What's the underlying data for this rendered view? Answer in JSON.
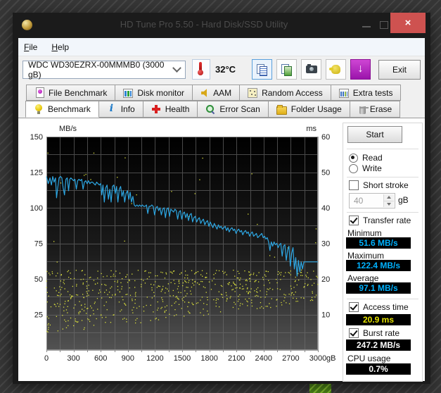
{
  "window": {
    "title": "HD Tune Pro 5.50 - Hard Disk/SSD Utility"
  },
  "menu": {
    "items": [
      {
        "label": "File"
      },
      {
        "label": "Help"
      }
    ]
  },
  "toolbar": {
    "drive_select_value": "WDC WD30EZRX-00MMMB0 (3000 gB)",
    "temperature": "32°C",
    "exit_label": "Exit"
  },
  "tabs": {
    "row_top": [
      {
        "label": "File Benchmark",
        "icon": "file-benchmark"
      },
      {
        "label": "Disk monitor",
        "icon": "disk-monitor"
      },
      {
        "label": "AAM",
        "icon": "aam"
      },
      {
        "label": "Random Access",
        "icon": "random-access"
      },
      {
        "label": "Extra tests",
        "icon": "extra-tests"
      }
    ],
    "row_bottom": [
      {
        "label": "Benchmark",
        "icon": "benchmark",
        "active": true
      },
      {
        "label": "Info",
        "icon": "info"
      },
      {
        "label": "Health",
        "icon": "health"
      },
      {
        "label": "Error Scan",
        "icon": "error-scan"
      },
      {
        "label": "Folder Usage",
        "icon": "folder-usage"
      },
      {
        "label": "Erase",
        "icon": "erase"
      }
    ]
  },
  "benchmark_panel": {
    "start_label": "Start",
    "read_label": "Read",
    "read_selected": true,
    "write_label": "Write",
    "write_selected": false,
    "short_stroke_label": "Short stroke",
    "short_stroke_checked": false,
    "capacity_value": "40",
    "capacity_unit": "gB",
    "transfer_rate_label": "Transfer rate",
    "transfer_rate_checked": true,
    "minimum_label": "Minimum",
    "minimum_value": "51.6 MB/s",
    "maximum_label": "Maximum",
    "maximum_value": "122.4 MB/s",
    "average_label": "Average",
    "average_value": "97.1 MB/s",
    "access_time_label": "Access time",
    "access_time_checked": true,
    "access_time_value": "20.9 ms",
    "burst_rate_label": "Burst rate",
    "burst_rate_checked": true,
    "burst_rate_value": "247.2 MB/s",
    "cpu_usage_label": "CPU usage",
    "cpu_usage_value": "0.7%"
  },
  "colors": {
    "transfer_line": "#2da6e2",
    "access_dots": "#dde23d",
    "value_cyan": "#00b2ff",
    "value_yellow": "#e6e400",
    "close_button": "#ce5250",
    "plot_top": "#000000",
    "plot_bottom": "#525252",
    "gridline": "#6f6f6f"
  },
  "chart_data": {
    "type": "line",
    "title": "Read benchmark: transfer rate and access time vs disk position",
    "x_axis": {
      "min": 0,
      "max": 3000,
      "tick_step": 300,
      "gridline_step": 150,
      "unit_suffix": "gB",
      "ticks": [
        0,
        300,
        600,
        900,
        1200,
        1500,
        1800,
        2100,
        2400,
        2700,
        3000
      ]
    },
    "left_axis": {
      "label": "MB/s",
      "min": 0,
      "max": 150,
      "gridline_step": 12.5,
      "ticks": [
        25,
        50,
        75,
        100,
        125,
        150
      ]
    },
    "right_axis": {
      "label": "ms",
      "min": 0,
      "max": 60,
      "ticks": [
        10,
        20,
        30,
        40,
        50,
        60
      ]
    },
    "legend": "none",
    "series": [
      {
        "name": "transfer-rate",
        "type": "line",
        "axis": "left",
        "unit": "MB/s",
        "color": "#2da6e2",
        "points": [
          [
            0,
            122
          ],
          [
            20,
            117
          ],
          [
            40,
            121
          ],
          [
            55,
            116
          ],
          [
            70,
            122
          ],
          [
            85,
            118
          ],
          [
            100,
            121
          ],
          [
            112,
            107
          ],
          [
            125,
            114
          ],
          [
            140,
            121
          ],
          [
            155,
            122
          ],
          [
            170,
            121
          ],
          [
            185,
            114
          ],
          [
            200,
            109
          ],
          [
            215,
            120
          ],
          [
            230,
            121
          ],
          [
            245,
            112
          ],
          [
            258,
            120
          ],
          [
            270,
            121
          ],
          [
            285,
            120
          ],
          [
            300,
            119
          ],
          [
            315,
            120
          ],
          [
            330,
            113
          ],
          [
            345,
            119
          ],
          [
            360,
            120
          ],
          [
            375,
            119
          ],
          [
            390,
            120
          ],
          [
            405,
            113
          ],
          [
            420,
            118
          ],
          [
            435,
            119
          ],
          [
            450,
            117
          ],
          [
            465,
            119
          ],
          [
            480,
            117
          ],
          [
            495,
            118
          ],
          [
            510,
            118
          ],
          [
            525,
            117
          ],
          [
            540,
            116
          ],
          [
            555,
            118
          ],
          [
            570,
            117
          ],
          [
            585,
            116
          ],
          [
            600,
            117
          ],
          [
            612,
            109
          ],
          [
            625,
            116
          ],
          [
            640,
            104
          ],
          [
            655,
            114
          ],
          [
            670,
            116
          ],
          [
            685,
            106
          ],
          [
            700,
            113
          ],
          [
            715,
            104
          ],
          [
            730,
            115
          ],
          [
            745,
            116
          ],
          [
            760,
            110
          ],
          [
            775,
            115
          ],
          [
            790,
            104
          ],
          [
            805,
            113
          ],
          [
            820,
            115
          ],
          [
            835,
            108
          ],
          [
            850,
            112
          ],
          [
            865,
            104
          ],
          [
            880,
            110
          ],
          [
            895,
            112
          ],
          [
            910,
            106
          ],
          [
            925,
            111
          ],
          [
            940,
            104
          ],
          [
            955,
            108
          ],
          [
            970,
            102
          ],
          [
            985,
            101
          ],
          [
            1000,
            102
          ],
          [
            1015,
            101
          ],
          [
            1030,
            102
          ],
          [
            1045,
            101
          ],
          [
            1060,
            102
          ],
          [
            1075,
            101
          ],
          [
            1090,
            101
          ],
          [
            1105,
            102
          ],
          [
            1120,
            96
          ],
          [
            1135,
            101
          ],
          [
            1150,
            101
          ],
          [
            1165,
            102
          ],
          [
            1180,
            101
          ],
          [
            1195,
            95
          ],
          [
            1210,
            100
          ],
          [
            1225,
            101
          ],
          [
            1240,
            98
          ],
          [
            1255,
            100
          ],
          [
            1270,
            95
          ],
          [
            1285,
            99
          ],
          [
            1300,
            100
          ],
          [
            1315,
            93
          ],
          [
            1330,
            99
          ],
          [
            1345,
            100
          ],
          [
            1360,
            94
          ],
          [
            1375,
            99
          ],
          [
            1390,
            98
          ],
          [
            1405,
            97
          ],
          [
            1420,
            99
          ],
          [
            1435,
            98
          ],
          [
            1450,
            92
          ],
          [
            1465,
            97
          ],
          [
            1480,
            98
          ],
          [
            1495,
            92
          ],
          [
            1510,
            96
          ],
          [
            1525,
            97
          ],
          [
            1540,
            93
          ],
          [
            1555,
            96
          ],
          [
            1570,
            91
          ],
          [
            1585,
            95
          ],
          [
            1600,
            96
          ],
          [
            1615,
            90
          ],
          [
            1630,
            93
          ],
          [
            1645,
            94
          ],
          [
            1660,
            90
          ],
          [
            1675,
            92
          ],
          [
            1690,
            93
          ],
          [
            1705,
            89
          ],
          [
            1720,
            91
          ],
          [
            1735,
            92
          ],
          [
            1750,
            88
          ],
          [
            1765,
            90
          ],
          [
            1780,
            91
          ],
          [
            1795,
            87
          ],
          [
            1810,
            90
          ],
          [
            1825,
            88
          ],
          [
            1840,
            86
          ],
          [
            1855,
            89
          ],
          [
            1870,
            87
          ],
          [
            1885,
            85
          ],
          [
            1900,
            88
          ],
          [
            1915,
            86
          ],
          [
            1930,
            87
          ],
          [
            1945,
            85
          ],
          [
            1960,
            86
          ],
          [
            1975,
            87
          ],
          [
            1990,
            84
          ],
          [
            2005,
            86
          ],
          [
            2020,
            83
          ],
          [
            2035,
            85
          ],
          [
            2050,
            86
          ],
          [
            2065,
            84
          ],
          [
            2080,
            85
          ],
          [
            2095,
            82
          ],
          [
            2110,
            84
          ],
          [
            2125,
            85
          ],
          [
            2140,
            83
          ],
          [
            2155,
            84
          ],
          [
            2170,
            81
          ],
          [
            2185,
            83
          ],
          [
            2200,
            84
          ],
          [
            2215,
            82
          ],
          [
            2230,
            83
          ],
          [
            2245,
            80
          ],
          [
            2260,
            82
          ],
          [
            2275,
            83
          ],
          [
            2290,
            80
          ],
          [
            2305,
            81
          ],
          [
            2320,
            82
          ],
          [
            2335,
            79
          ],
          [
            2350,
            80
          ],
          [
            2365,
            81
          ],
          [
            2380,
            82
          ],
          [
            2395,
            79
          ],
          [
            2410,
            80
          ],
          [
            2425,
            78
          ],
          [
            2440,
            79
          ],
          [
            2455,
            76
          ],
          [
            2470,
            70
          ],
          [
            2485,
            76
          ],
          [
            2500,
            73
          ],
          [
            2515,
            76
          ],
          [
            2530,
            74
          ],
          [
            2545,
            75
          ],
          [
            2560,
            72
          ],
          [
            2575,
            74
          ],
          [
            2590,
            75
          ],
          [
            2605,
            66
          ],
          [
            2620,
            73
          ],
          [
            2635,
            74
          ],
          [
            2650,
            63
          ],
          [
            2665,
            70
          ],
          [
            2680,
            73
          ],
          [
            2695,
            59
          ],
          [
            2710,
            68
          ],
          [
            2725,
            72
          ],
          [
            2740,
            57
          ],
          [
            2755,
            65
          ],
          [
            2770,
            52
          ],
          [
            2785,
            63
          ],
          [
            2800,
            55
          ],
          [
            2815,
            62
          ],
          [
            2830,
            57
          ],
          [
            2845,
            62
          ],
          [
            2860,
            62
          ],
          [
            2880,
            62
          ],
          [
            2910,
            62
          ],
          [
            2950,
            62
          ],
          [
            3000,
            62
          ]
        ],
        "stats": {
          "minimum": 51.6,
          "maximum": 122.4,
          "average": 97.1
        }
      },
      {
        "name": "access-time",
        "type": "scatter",
        "axis": "right",
        "unit": "ms",
        "color": "#dde23d",
        "summary": "dense scatter of dots between ~5 ms and ~22.5 ms; lower edge rises from ~5 ms at position 0 to ~13 ms at 3000 gB; sparse outliers up to ~58 ms; average 20.9 ms",
        "generator": {
          "seed": 7,
          "count": 640,
          "x_skew": 1.12,
          "band_low_start_ms": 4.5,
          "band_low_end_ms": 13.5,
          "band_high_ms": 22.5,
          "outlier_count": 26,
          "outlier_min_ms": 23,
          "outlier_max_ms": 58
        }
      }
    ]
  }
}
